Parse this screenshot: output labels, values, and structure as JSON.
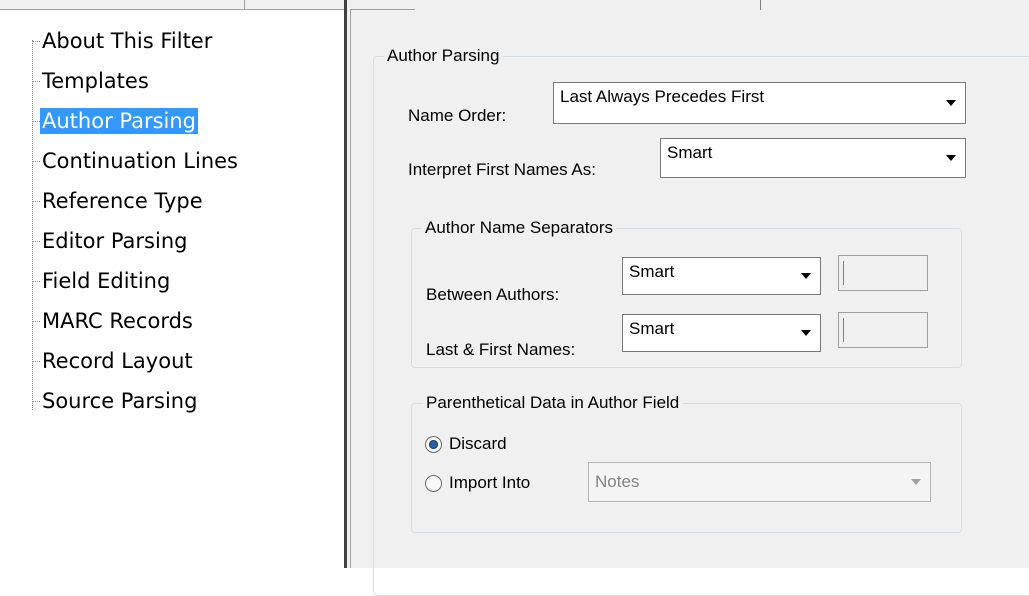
{
  "tree": {
    "items": [
      {
        "label": "About This Filter",
        "selected": false
      },
      {
        "label": "Templates",
        "selected": false
      },
      {
        "label": "Author Parsing",
        "selected": true
      },
      {
        "label": "Continuation Lines",
        "selected": false
      },
      {
        "label": "Reference Type",
        "selected": false
      },
      {
        "label": "Editor Parsing",
        "selected": false
      },
      {
        "label": "Field Editing",
        "selected": false
      },
      {
        "label": "MARC Records",
        "selected": false
      },
      {
        "label": "Record Layout",
        "selected": false
      },
      {
        "label": "Source Parsing",
        "selected": false
      }
    ]
  },
  "author_parsing": {
    "group_title": "Author Parsing",
    "name_order": {
      "label": "Name Order:",
      "value": "Last Always Precedes First"
    },
    "interpret_first": {
      "label": "Interpret First Names As:",
      "value": "Smart"
    },
    "separators": {
      "title": "Author Name Separators",
      "between_authors": {
        "label": "Between Authors:",
        "value": "Smart",
        "text": ""
      },
      "last_first": {
        "label": "Last & First Names:",
        "value": "Smart",
        "text": ""
      }
    },
    "parenthetical": {
      "title": "Parenthetical Data in Author Field",
      "discard": {
        "label": "Discard",
        "checked": true
      },
      "import_into": {
        "label": "Import Into",
        "checked": false,
        "value": "Notes",
        "enabled": false
      }
    }
  },
  "colors": {
    "selection": "#3399ff",
    "panel_bg": "#f0f0f0",
    "radio_dot": "#2b5fa6"
  },
  "icons": [
    "dropdown-arrow-icon",
    "radio-checked-icon",
    "radio-unchecked-icon"
  ]
}
